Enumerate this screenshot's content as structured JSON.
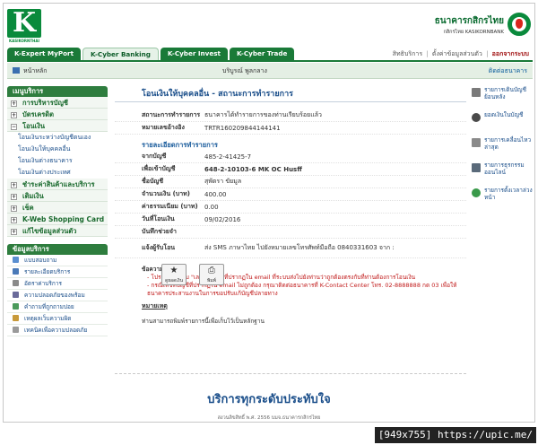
{
  "header": {
    "logo_text": "KASIKORNTHAI",
    "bank_name_th": "ธนาคารกสิกรไทย",
    "bank_name_en": "กสิกรไทย KASIKORNBANK"
  },
  "tabs": [
    {
      "label": "K-Expert MyPort"
    },
    {
      "label": "K-Cyber Banking"
    },
    {
      "label": "K-Cyber Invest"
    },
    {
      "label": "K-Cyber Trade"
    }
  ],
  "toplinks": {
    "services": "สิทธิบริการ",
    "settings": "ตั้งค่าข้อมูลส่วนตัว",
    "logout": "ออกจากระบบ"
  },
  "subbar": {
    "home": "หน้าหลัก",
    "user": "บริบูรณ์ พูลกลาง",
    "contact": "ติดต่อธนาคาร"
  },
  "sidebar": {
    "menu_title": "เมนูบริการ",
    "items": [
      {
        "label": "การบริหารบัญชี"
      },
      {
        "label": "บัตรเครดิต"
      },
      {
        "label": "โอนเงิน"
      }
    ],
    "transfer_sub": [
      {
        "label": "โอนเงินระหว่างบัญชีตนเอง"
      },
      {
        "label": "โอนเงินให้บุคคลอื่น"
      },
      {
        "label": "โอนเงินต่างธนาคาร"
      },
      {
        "label": "โอนเงินต่างประเทศ"
      }
    ],
    "items_after": [
      {
        "label": "ชำระค่าสินค้าและบริการ"
      },
      {
        "label": "เติมเงิน"
      },
      {
        "label": "เช็ค"
      },
      {
        "label": "K-Web Shopping Card"
      },
      {
        "label": "แก้ไขข้อมูลส่วนตัว"
      }
    ],
    "info_title": "ข้อมูลบริการ",
    "info_items": [
      {
        "label": "แบบสอบถาม"
      },
      {
        "label": "รายละเอียดบริการ"
      },
      {
        "label": "อัตราค่าบริการ"
      },
      {
        "label": "ความปลอดภัยของพร้อม"
      },
      {
        "label": "คำถามที่ถูกถามบ่อย"
      },
      {
        "label": "เหตุผลเว็บความผิด"
      },
      {
        "label": "เทคนิคเพื่อความปลอดภัย"
      }
    ]
  },
  "main": {
    "title": "โอนเงินให้บุคคลอื่น - สถานะการทำรายการ",
    "status_label": "สถานะการทำรายการ",
    "status_value": "ธนาคารได้ทำรายการของท่านเรียบร้อยแล้ว",
    "ref_label": "หมายเลขอ้างอิง",
    "ref_value": "TRTR160209844144141",
    "section_title": "รายละเอียดการทำรายการ",
    "from_label": "จากบัญชี",
    "from_value": "485-2-41425-7",
    "to_label": "เพื่อเข้าบัญชี",
    "to_value": "648-2-10103-6 MK OC Husff",
    "name_label": "ชื่อบัญชี",
    "name_value": "สุพัตรา ขัยมูล",
    "amount_label": "จำนวนเงิน (บาท)",
    "amount_value": "400.00",
    "fee_label": "ค่าธรรมเนียม (บาท)",
    "fee_value": "0.00",
    "date_label": "วันที่โอนเงิน",
    "date_value": "09/02/2016",
    "memo_label": "บันทึกช่วยจำ",
    "memo_value": "",
    "notify_label": "แจ้งผู้รับโอน",
    "notify_value": "ส่ง SMS ภาษาไทย ไปยังหมายเลขโทรศัพท์มือถือ 0840331603 จาก :",
    "note_heading": "ข้อความสำคัญ :",
    "note_line1": "- โปรดตรวจสอบ \"เลขที่บัญชี\" ที่ปรากฏใน email ที่ระบบส่งไปยังท่านว่าถูกต้องตรงกับที่ท่านต้องการโอนเงิน",
    "note_line2": "- กรณีเลขที่บัญชีที่ปรากฏใน email ไม่ถูกต้อง กรุณาติดต่อธนาคารที่ K-Contact Center โทร. 02-8888888 กด 03 เพื่อให้ธนาคารประสานงานในการขอปรับแก้บัญชีปลายทาง",
    "note_foot": "หมายเหตุ",
    "note_last": "ท่านสามารถพิมพ์รายการนี้เพื่อเก็บไว้เป็นหลักฐาน"
  },
  "actions": {
    "save_label": "ดูยอดเงิน",
    "print_label": "พิมพ์"
  },
  "right_panel": [
    {
      "label": "รายการเดินบัญชีย้อนหลัง",
      "icon": "statement-icon"
    },
    {
      "label": "ยอดเงินในบัญชี",
      "icon": "balance-icon"
    },
    {
      "label": "รายการเคลื่อนไหวล่าสุด",
      "icon": "calendar-icon"
    },
    {
      "label": "รายการธุรกรรมออนไลน์",
      "icon": "monitor-icon"
    },
    {
      "label": "รายการตั้งเวลาล่วงหน้า",
      "icon": "clock-icon"
    }
  ],
  "footer": {
    "slogan": "บริการทุกระดับประทับใจ",
    "copyright": "สงวนลิขสิทธิ์ พ.ศ. 2556 บมจ.ธนาคารกสิกรไทย"
  },
  "watermark": "[949x755] https://upic.me/"
}
